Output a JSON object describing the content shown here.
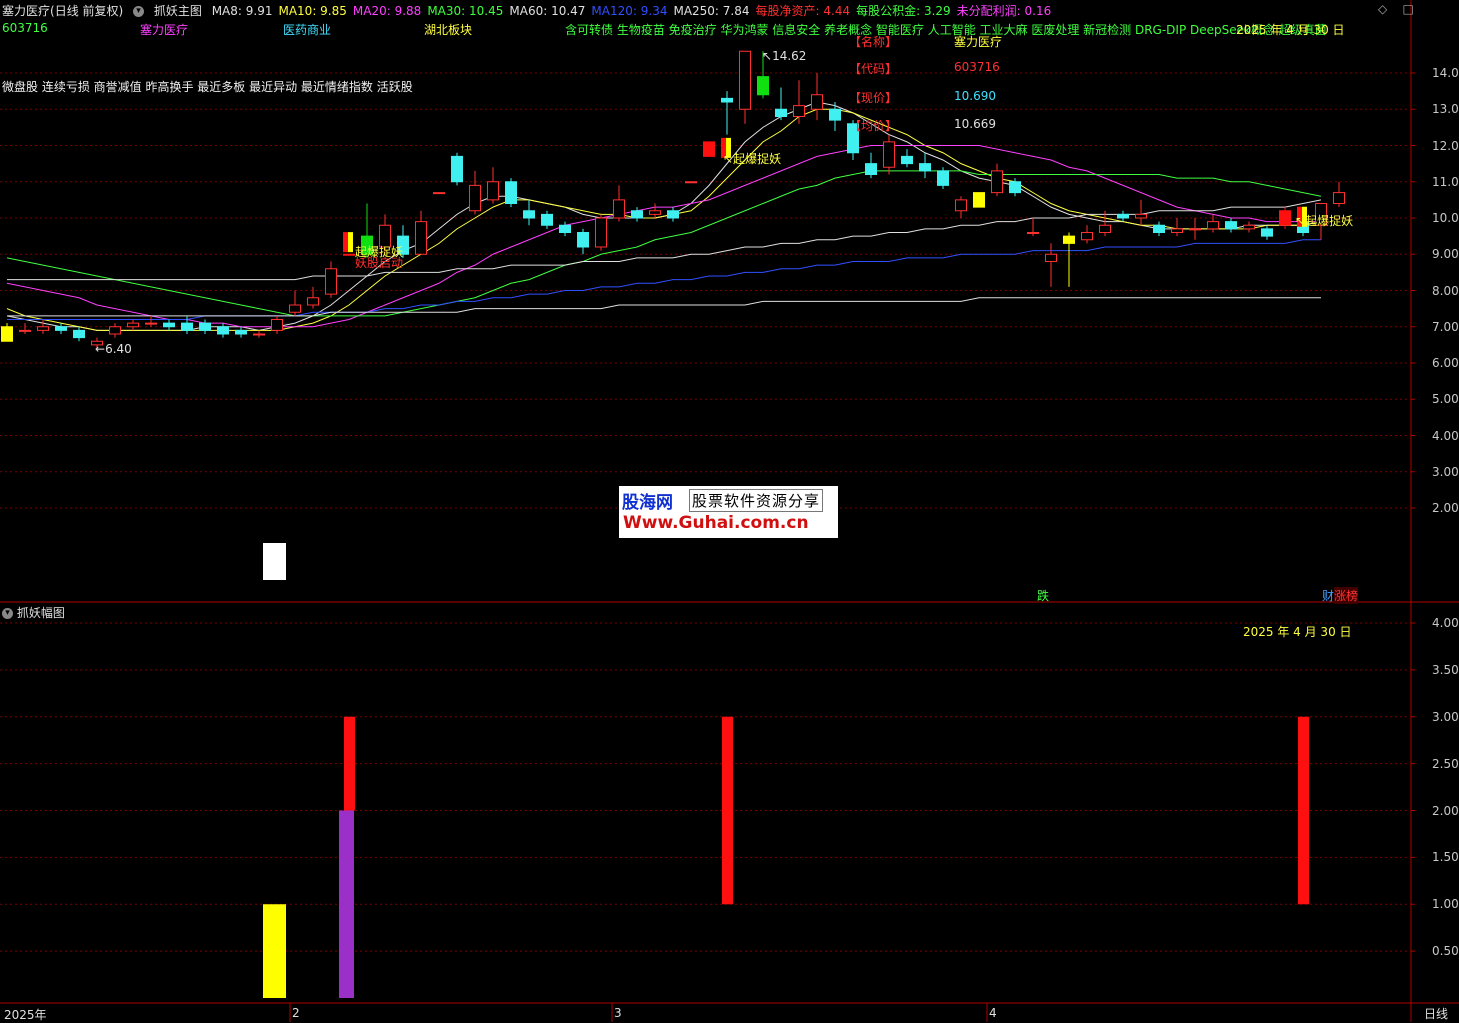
{
  "main_header": {
    "stock": "塞力医疗",
    "mode": "(日线 前复权)",
    "indicator": "抓妖主图",
    "items": [
      {
        "text": "MA8: 9.91",
        "color": "#e0e0e0"
      },
      {
        "text": "MA10: 9.85",
        "color": "#ffff40"
      },
      {
        "text": "MA20: 9.88",
        "color": "#ff40ff"
      },
      {
        "text": "MA30: 10.45",
        "color": "#40ff40"
      },
      {
        "text": "MA60: 10.47",
        "color": "#e0e0e0"
      },
      {
        "text": "MA120: 9.34",
        "color": "#3050ff"
      },
      {
        "text": "MA250: 7.84",
        "color": "#e0e0e0"
      },
      {
        "text": "每股净资产: 4.44",
        "color": "#ff3030"
      },
      {
        "text": "每股公积金: 3.29",
        "color": "#40ff40"
      },
      {
        "text": "未分配利润: 0.16",
        "color": "#ff40ff"
      }
    ]
  },
  "row2": {
    "code": "603716",
    "name": "塞力医疗",
    "industry": "医药商业",
    "region": "湖北板块",
    "concepts": "含可转债 生物疫苗 免疫治疗 华为鸿蒙 信息安全 养老概念 智能医疗 人工智能 工业大麻 医废处理 新冠检测 DRG-DIP DeepSeek概念 超级真菌",
    "date": "2025 年 4 月 30 日"
  },
  "row3": "微盘股 连续亏损 商誉减值 昨高换手 最近多板 最近异动 最近情绪指数 活跃股",
  "info_panel": {
    "labels": [
      "【名称】",
      "【代码】",
      "【现价】",
      "【均价】"
    ],
    "values": [
      {
        "text": "塞力医疗",
        "color": "#ffff40"
      },
      {
        "text": "603716",
        "color": "#ff3030"
      },
      {
        "text": "10.690",
        "color": "#40e0ff"
      },
      {
        "text": "10.669",
        "color": "#e0e0e0"
      }
    ]
  },
  "price_axis": [
    "14.00",
    "13.00",
    "12.00",
    "11.00",
    "10.00",
    "9.00",
    "8.00",
    "7.00",
    "6.00",
    "5.00",
    "4.00",
    "3.00",
    "2.00"
  ],
  "annotations": {
    "high": "14.62",
    "low": "6.40",
    "signal1": "起爆捉妖",
    "signal1_sub": "妖股启动",
    "signal2": "起爆捉妖",
    "signal3": "起爆捉妖",
    "die": "跌",
    "cai": "财",
    "zhangting": "涨榜"
  },
  "sub_header": {
    "indicator": "抓妖幅图",
    "date": "2025 年 4 月 30 日"
  },
  "sub_axis": [
    "4.00",
    "3.50",
    "3.00",
    "2.50",
    "2.00",
    "1.50",
    "1.00",
    "0.50"
  ],
  "x_axis": {
    "labels": [
      "2025年",
      "2",
      "3",
      "4"
    ],
    "right": "日线"
  },
  "watermark": {
    "top": "股海网",
    "slogan": "股票软件资源分享",
    "url": "Www.Guhai.com.cn"
  },
  "colors": {
    "up": "#ff3030",
    "down": "#40f0f0",
    "grid": "#7a0000"
  },
  "chart_data": {
    "type": "candlestick",
    "price_range": [
      1.0,
      15.0
    ],
    "candles": [
      {
        "o": 7.0,
        "c": 6.6,
        "h": 7.1,
        "l": 6.6,
        "color": "yellow"
      },
      {
        "o": 6.9,
        "c": 6.9,
        "h": 7.1,
        "l": 6.8
      },
      {
        "o": 6.9,
        "c": 7.0,
        "h": 7.2,
        "l": 6.8
      },
      {
        "o": 7.0,
        "c": 6.9,
        "h": 7.1,
        "l": 6.8
      },
      {
        "o": 6.9,
        "c": 6.7,
        "h": 7.0,
        "l": 6.6
      },
      {
        "o": 6.5,
        "c": 6.6,
        "h": 6.7,
        "l": 6.4
      },
      {
        "o": 6.8,
        "c": 7.0,
        "h": 7.1,
        "l": 6.7
      },
      {
        "o": 7.0,
        "c": 7.1,
        "h": 7.2,
        "l": 6.9
      },
      {
        "o": 7.1,
        "c": 7.1,
        "h": 7.3,
        "l": 7.0
      },
      {
        "o": 7.1,
        "c": 7.0,
        "h": 7.2,
        "l": 6.9
      },
      {
        "o": 7.1,
        "c": 6.9,
        "h": 7.3,
        "l": 6.8
      },
      {
        "o": 7.1,
        "c": 6.9,
        "h": 7.2,
        "l": 6.8
      },
      {
        "o": 7.0,
        "c": 6.8,
        "h": 7.1,
        "l": 6.7
      },
      {
        "o": 6.9,
        "c": 6.8,
        "h": 7.0,
        "l": 6.7
      },
      {
        "o": 6.8,
        "c": 6.8,
        "h": 6.9,
        "l": 6.7
      },
      {
        "o": 6.9,
        "c": 7.2,
        "h": 7.3,
        "l": 6.8
      },
      {
        "o": 7.4,
        "c": 7.6,
        "h": 8.0,
        "l": 7.3
      },
      {
        "o": 7.6,
        "c": 7.8,
        "h": 8.1,
        "l": 7.5
      },
      {
        "o": 7.9,
        "c": 8.6,
        "h": 8.8,
        "l": 7.8
      },
      {
        "o": 9.0,
        "c": 9.0,
        "h": 9.0,
        "l": 9.0,
        "color": "red"
      },
      {
        "o": 9.5,
        "c": 9.0,
        "h": 10.4,
        "l": 8.9,
        "color": "green"
      },
      {
        "o": 9.2,
        "c": 9.8,
        "h": 10.1,
        "l": 9.0
      },
      {
        "o": 9.5,
        "c": 9.0,
        "h": 9.8,
        "l": 8.9
      },
      {
        "o": 9.0,
        "c": 9.9,
        "h": 10.2,
        "l": 9.0
      },
      {
        "o": 10.7,
        "c": 10.7,
        "h": 10.7,
        "l": 10.7
      },
      {
        "o": 11.7,
        "c": 11.0,
        "h": 11.8,
        "l": 10.9
      },
      {
        "o": 10.2,
        "c": 10.9,
        "h": 11.3,
        "l": 10.1
      },
      {
        "o": 10.5,
        "c": 11.0,
        "h": 11.4,
        "l": 10.4
      },
      {
        "o": 11.0,
        "c": 10.4,
        "h": 11.1,
        "l": 10.3
      },
      {
        "o": 10.2,
        "c": 10.0,
        "h": 10.5,
        "l": 9.8
      },
      {
        "o": 10.1,
        "c": 9.8,
        "h": 10.2,
        "l": 9.7
      },
      {
        "o": 9.8,
        "c": 9.6,
        "h": 9.9,
        "l": 9.5
      },
      {
        "o": 9.6,
        "c": 9.2,
        "h": 9.7,
        "l": 9.0
      },
      {
        "o": 9.2,
        "c": 10.0,
        "h": 10.1,
        "l": 9.1
      },
      {
        "o": 10.0,
        "c": 10.5,
        "h": 10.9,
        "l": 9.9
      },
      {
        "o": 10.2,
        "c": 10.0,
        "h": 10.3,
        "l": 9.9
      },
      {
        "o": 10.1,
        "c": 10.2,
        "h": 10.4,
        "l": 10.0
      },
      {
        "o": 10.2,
        "c": 10.0,
        "h": 10.3,
        "l": 9.9
      },
      {
        "o": 11.0,
        "c": 11.0,
        "h": 11.0,
        "l": 11.0
      },
      {
        "o": 11.7,
        "c": 12.1,
        "h": 12.1,
        "l": 11.7,
        "color": "red"
      },
      {
        "o": 13.3,
        "c": 13.2,
        "h": 13.5,
        "l": 12.3
      },
      {
        "o": 13.0,
        "c": 14.6,
        "h": 14.6,
        "l": 12.6
      },
      {
        "o": 13.9,
        "c": 13.4,
        "h": 14.6,
        "l": 13.3,
        "color": "green"
      },
      {
        "o": 13.0,
        "c": 12.8,
        "h": 13.6,
        "l": 12.7
      },
      {
        "o": 12.8,
        "c": 13.1,
        "h": 13.8,
        "l": 12.6
      },
      {
        "o": 13.0,
        "c": 13.4,
        "h": 14.0,
        "l": 12.7
      },
      {
        "o": 13.0,
        "c": 12.7,
        "h": 13.2,
        "l": 12.4
      },
      {
        "o": 12.6,
        "c": 11.8,
        "h": 12.7,
        "l": 11.6
      },
      {
        "o": 11.5,
        "c": 11.2,
        "h": 11.8,
        "l": 11.1
      },
      {
        "o": 11.4,
        "c": 12.1,
        "h": 12.3,
        "l": 11.2
      },
      {
        "o": 11.7,
        "c": 11.5,
        "h": 11.9,
        "l": 11.4
      },
      {
        "o": 11.5,
        "c": 11.3,
        "h": 11.8,
        "l": 11.1
      },
      {
        "o": 11.3,
        "c": 10.9,
        "h": 11.4,
        "l": 10.8
      },
      {
        "o": 10.2,
        "c": 10.5,
        "h": 10.6,
        "l": 10.0
      },
      {
        "o": 10.3,
        "c": 10.7,
        "h": 10.7,
        "l": 10.3,
        "color": "yellow"
      },
      {
        "o": 10.7,
        "c": 11.3,
        "h": 11.5,
        "l": 10.6
      },
      {
        "o": 11.0,
        "c": 10.7,
        "h": 11.1,
        "l": 10.6
      },
      {
        "o": 9.6,
        "c": 9.6,
        "h": 10.0,
        "l": 9.5
      },
      {
        "o": 8.8,
        "c": 9.0,
        "h": 9.3,
        "l": 8.1
      },
      {
        "o": 9.5,
        "c": 9.3,
        "h": 9.6,
        "l": 8.1,
        "color": "yellow"
      },
      {
        "o": 9.4,
        "c": 9.6,
        "h": 9.8,
        "l": 9.3
      },
      {
        "o": 9.6,
        "c": 9.8,
        "h": 10.2,
        "l": 9.5
      },
      {
        "o": 10.1,
        "c": 10.0,
        "h": 10.2,
        "l": 9.9
      },
      {
        "o": 10.0,
        "c": 10.1,
        "h": 10.5,
        "l": 9.8
      },
      {
        "o": 9.8,
        "c": 9.6,
        "h": 9.9,
        "l": 9.5
      },
      {
        "o": 9.6,
        "c": 9.7,
        "h": 10.0,
        "l": 9.5
      },
      {
        "o": 9.7,
        "c": 9.7,
        "h": 10.0,
        "l": 9.4
      },
      {
        "o": 9.7,
        "c": 9.9,
        "h": 10.1,
        "l": 9.6
      },
      {
        "o": 9.9,
        "c": 9.7,
        "h": 10.0,
        "l": 9.6
      },
      {
        "o": 9.7,
        "c": 9.8,
        "h": 9.9,
        "l": 9.6
      },
      {
        "o": 9.7,
        "c": 9.5,
        "h": 9.8,
        "l": 9.4
      },
      {
        "o": 10.2,
        "c": 9.8,
        "h": 10.3,
        "l": 9.7,
        "color": "red"
      },
      {
        "o": 9.9,
        "c": 9.6,
        "h": 10.0,
        "l": 9.5
      },
      {
        "o": 9.8,
        "c": 10.4,
        "h": 10.4,
        "l": 9.4
      },
      {
        "o": 10.4,
        "c": 10.7,
        "h": 11.0,
        "l": 10.3
      }
    ],
    "ma_lines": [
      {
        "name": "MA8",
        "color": "#e0e0e0",
        "values": [
          7.3,
          7.2,
          7.1,
          7.0,
          7.0,
          6.9,
          6.9,
          6.9,
          6.9,
          6.9,
          6.9,
          7.0,
          7.0,
          7.0,
          6.9,
          7.0,
          7.1,
          7.3,
          7.6,
          8.0,
          8.4,
          8.8,
          9.1,
          9.3,
          9.7,
          10.1,
          10.4,
          10.6,
          10.6,
          10.5,
          10.4,
          10.3,
          10.1,
          10.0,
          10.0,
          10.0,
          10.0,
          10.1,
          10.4,
          10.9,
          11.5,
          12.1,
          12.5,
          12.8,
          13.0,
          13.2,
          13.1,
          12.9,
          12.6,
          12.3,
          12.1,
          11.8,
          11.6,
          11.3,
          11.1,
          11.0,
          10.9,
          10.6,
          10.3,
          10.1,
          10.0,
          9.9,
          9.9,
          9.8,
          9.7,
          9.7,
          9.7,
          9.7,
          9.7,
          9.8,
          9.8,
          9.8,
          9.8,
          9.9
        ]
      },
      {
        "name": "MA10",
        "color": "#ffff40",
        "values": [
          7.5,
          7.3,
          7.2,
          7.1,
          7.0,
          6.9,
          6.9,
          6.9,
          6.9,
          6.9,
          6.9,
          6.9,
          6.9,
          6.9,
          6.9,
          6.9,
          7.0,
          7.1,
          7.3,
          7.6,
          8.0,
          8.4,
          8.7,
          9.0,
          9.3,
          9.7,
          10.0,
          10.3,
          10.5,
          10.5,
          10.4,
          10.3,
          10.2,
          10.1,
          10.1,
          10.0,
          10.0,
          10.1,
          10.2,
          10.6,
          11.1,
          11.6,
          12.1,
          12.4,
          12.8,
          13.0,
          13.0,
          12.9,
          12.7,
          12.5,
          12.3,
          12.0,
          11.8,
          11.5,
          11.3,
          11.1,
          11.0,
          10.7,
          10.4,
          10.2,
          10.1,
          10.0,
          9.9,
          9.8,
          9.8,
          9.7,
          9.7,
          9.7,
          9.7,
          9.7,
          9.8,
          9.8,
          9.8,
          9.9
        ]
      },
      {
        "name": "MA20",
        "color": "#ff40ff",
        "values": [
          8.2,
          8.1,
          8.0,
          7.9,
          7.8,
          7.6,
          7.5,
          7.4,
          7.3,
          7.2,
          7.2,
          7.1,
          7.1,
          7.0,
          7.0,
          7.0,
          7.0,
          7.0,
          7.1,
          7.2,
          7.4,
          7.6,
          7.8,
          8.0,
          8.2,
          8.5,
          8.7,
          9.0,
          9.2,
          9.4,
          9.6,
          9.8,
          9.9,
          10.0,
          10.1,
          10.2,
          10.3,
          10.3,
          10.4,
          10.5,
          10.7,
          10.9,
          11.1,
          11.3,
          11.5,
          11.7,
          11.8,
          11.9,
          12.0,
          12.0,
          12.0,
          12.0,
          12.0,
          12.0,
          12.0,
          11.9,
          11.8,
          11.7,
          11.6,
          11.4,
          11.3,
          11.1,
          10.9,
          10.7,
          10.5,
          10.3,
          10.2,
          10.1,
          10.0,
          10.0,
          9.9,
          9.9,
          9.9,
          9.9
        ]
      },
      {
        "name": "MA30",
        "color": "#40ff40",
        "values": [
          8.9,
          8.8,
          8.7,
          8.6,
          8.5,
          8.4,
          8.3,
          8.2,
          8.1,
          8.0,
          7.9,
          7.8,
          7.7,
          7.6,
          7.5,
          7.4,
          7.3,
          7.3,
          7.3,
          7.3,
          7.3,
          7.3,
          7.4,
          7.5,
          7.6,
          7.7,
          7.8,
          8.0,
          8.2,
          8.3,
          8.5,
          8.7,
          8.8,
          9.0,
          9.1,
          9.2,
          9.4,
          9.5,
          9.6,
          9.8,
          10.0,
          10.2,
          10.4,
          10.6,
          10.8,
          10.9,
          11.1,
          11.2,
          11.3,
          11.3,
          11.3,
          11.3,
          11.3,
          11.3,
          11.2,
          11.2,
          11.2,
          11.2,
          11.2,
          11.2,
          11.2,
          11.2,
          11.2,
          11.2,
          11.2,
          11.1,
          11.1,
          11.1,
          11.0,
          11.0,
          10.9,
          10.8,
          10.7,
          10.6
        ]
      },
      {
        "name": "MA60",
        "color": "#e0e0e0",
        "values": [
          8.3,
          8.3,
          8.3,
          8.3,
          8.3,
          8.3,
          8.3,
          8.3,
          8.3,
          8.3,
          8.3,
          8.3,
          8.3,
          8.3,
          8.3,
          8.3,
          8.3,
          8.4,
          8.4,
          8.4,
          8.4,
          8.5,
          8.5,
          8.5,
          8.5,
          8.6,
          8.6,
          8.6,
          8.7,
          8.7,
          8.7,
          8.7,
          8.8,
          8.8,
          8.8,
          8.9,
          8.9,
          8.9,
          9.0,
          9.0,
          9.1,
          9.2,
          9.2,
          9.3,
          9.3,
          9.4,
          9.4,
          9.5,
          9.5,
          9.6,
          9.6,
          9.7,
          9.7,
          9.8,
          9.8,
          9.9,
          9.9,
          10.0,
          10.0,
          10.0,
          10.1,
          10.1,
          10.1,
          10.1,
          10.2,
          10.2,
          10.2,
          10.2,
          10.3,
          10.3,
          10.3,
          10.3,
          10.4,
          10.5
        ]
      },
      {
        "name": "MA120",
        "color": "#3050ff",
        "values": [
          7.2,
          7.2,
          7.2,
          7.2,
          7.2,
          7.2,
          7.2,
          7.2,
          7.2,
          7.2,
          7.2,
          7.3,
          7.3,
          7.3,
          7.3,
          7.3,
          7.3,
          7.4,
          7.4,
          7.4,
          7.4,
          7.5,
          7.5,
          7.6,
          7.6,
          7.7,
          7.7,
          7.8,
          7.8,
          7.9,
          7.9,
          8.0,
          8.0,
          8.1,
          8.1,
          8.2,
          8.2,
          8.3,
          8.3,
          8.4,
          8.4,
          8.5,
          8.5,
          8.6,
          8.6,
          8.7,
          8.7,
          8.8,
          8.8,
          8.8,
          8.9,
          8.9,
          8.9,
          9.0,
          9.0,
          9.0,
          9.0,
          9.1,
          9.1,
          9.1,
          9.1,
          9.2,
          9.2,
          9.2,
          9.2,
          9.2,
          9.3,
          9.3,
          9.3,
          9.3,
          9.3,
          9.3,
          9.4,
          9.4
        ]
      },
      {
        "name": "MA250",
        "color": "#e0e0e0",
        "values": [
          7.3,
          7.3,
          7.3,
          7.3,
          7.3,
          7.3,
          7.3,
          7.3,
          7.3,
          7.3,
          7.3,
          7.3,
          7.3,
          7.3,
          7.3,
          7.3,
          7.3,
          7.3,
          7.4,
          7.4,
          7.4,
          7.4,
          7.4,
          7.4,
          7.4,
          7.4,
          7.5,
          7.5,
          7.5,
          7.5,
          7.5,
          7.5,
          7.5,
          7.5,
          7.6,
          7.6,
          7.6,
          7.6,
          7.6,
          7.6,
          7.6,
          7.6,
          7.7,
          7.7,
          7.7,
          7.7,
          7.7,
          7.7,
          7.7,
          7.7,
          7.7,
          7.7,
          7.7,
          7.7,
          7.8,
          7.8,
          7.8,
          7.8,
          7.8,
          7.8,
          7.8,
          7.8,
          7.8,
          7.8,
          7.8,
          7.8,
          7.8,
          7.8,
          7.8,
          7.8,
          7.8,
          7.8,
          7.8,
          7.8
        ]
      }
    ],
    "sub_bars": [
      {
        "index": 15,
        "from": 0.0,
        "to": 1.0,
        "color": "#ffff00"
      },
      {
        "index": 19,
        "from": 2.0,
        "to": 3.0,
        "color": "#ff1010"
      },
      {
        "index": 19,
        "from": 0.0,
        "to": 2.0,
        "color": "#9a30c8"
      },
      {
        "index": 40,
        "from": 1.0,
        "to": 3.0,
        "color": "#ff1010"
      },
      {
        "index": 72,
        "from": 1.0,
        "to": 3.0,
        "color": "#ff1010"
      }
    ],
    "sub_range": [
      0.0,
      4.2
    ]
  }
}
